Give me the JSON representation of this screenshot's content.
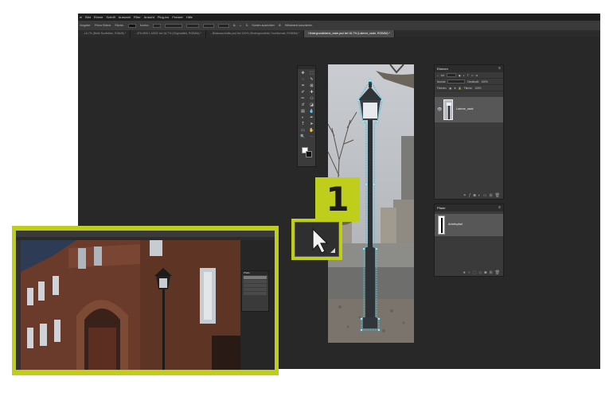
{
  "menubar": {
    "items": [
      "ei",
      "Bild",
      "Ebene",
      "Schrift",
      "Auswahl",
      "Filter",
      "Ansicht",
      "Plug-ins",
      "Fenster",
      "Hilfe"
    ]
  },
  "optionsbar": {
    "preset_label": "Vorgabe:",
    "preset_value": "Primo Ebene",
    "fill_label": "Fläche:",
    "stroke_label": "Kontur:",
    "stroke_value": "",
    "edges_label": "Kanten ausrichten",
    "right_label": "Hilfsebene kaschieren"
  },
  "tabs": [
    {
      "label": "...16,7% (Belle Soziletten, RGB/8) *",
      "active": false
    },
    {
      "label": "...376 ARB 1 ASSE bei 16,7% (Originalbild, RGB/8#) *",
      "active": false
    },
    {
      "label": "...Bildausschnitte.psd bei 100% (Hintergrundbild, Hochformat, RGB/8#) *",
      "active": false
    },
    {
      "label": "Hintergrundebene_raste.psd bei 16,7% (Laterne_raste, RGB/8#) *",
      "active": true
    }
  ],
  "layers_panel": {
    "title": "Ebenen",
    "kind_label": "Art",
    "blend_mode": "Normal",
    "opacity_label": "Deckkraft:",
    "opacity_value": "100%",
    "lock_label": "Fixieren:",
    "fill_label": "Fläche:",
    "fill_value": "100%",
    "layer_name": "Laterne_raste"
  },
  "paths_panel": {
    "title": "Pfade",
    "path_name": "Arbeitspfad"
  },
  "callout": {
    "number": "1",
    "accent_color": "#bfcd1b"
  },
  "inset": {
    "panel_title": "Pfade"
  },
  "icons": {
    "tools": [
      "move-icon",
      "marquee-icon",
      "lasso-icon",
      "quick-select-icon",
      "crop-icon",
      "frame-icon",
      "eyedropper-icon",
      "heal-icon",
      "brush-icon",
      "stamp-icon",
      "history-brush-icon",
      "eraser-icon",
      "gradient-icon",
      "blur-icon",
      "dodge-icon",
      "pen-icon",
      "type-icon",
      "path-select-icon",
      "rectangle-icon",
      "hand-icon",
      "zoom-icon",
      "more-icon"
    ],
    "tool_glyphs": [
      "✥",
      "⬚",
      "◌",
      "✎",
      "⌗",
      "⊠",
      "✐",
      "✚",
      "✏",
      "⚇",
      "↺",
      "◪",
      "▤",
      "💧",
      "◐",
      "✒",
      "T",
      "➤",
      "▭",
      "✋",
      "🔍",
      "⋯"
    ]
  }
}
